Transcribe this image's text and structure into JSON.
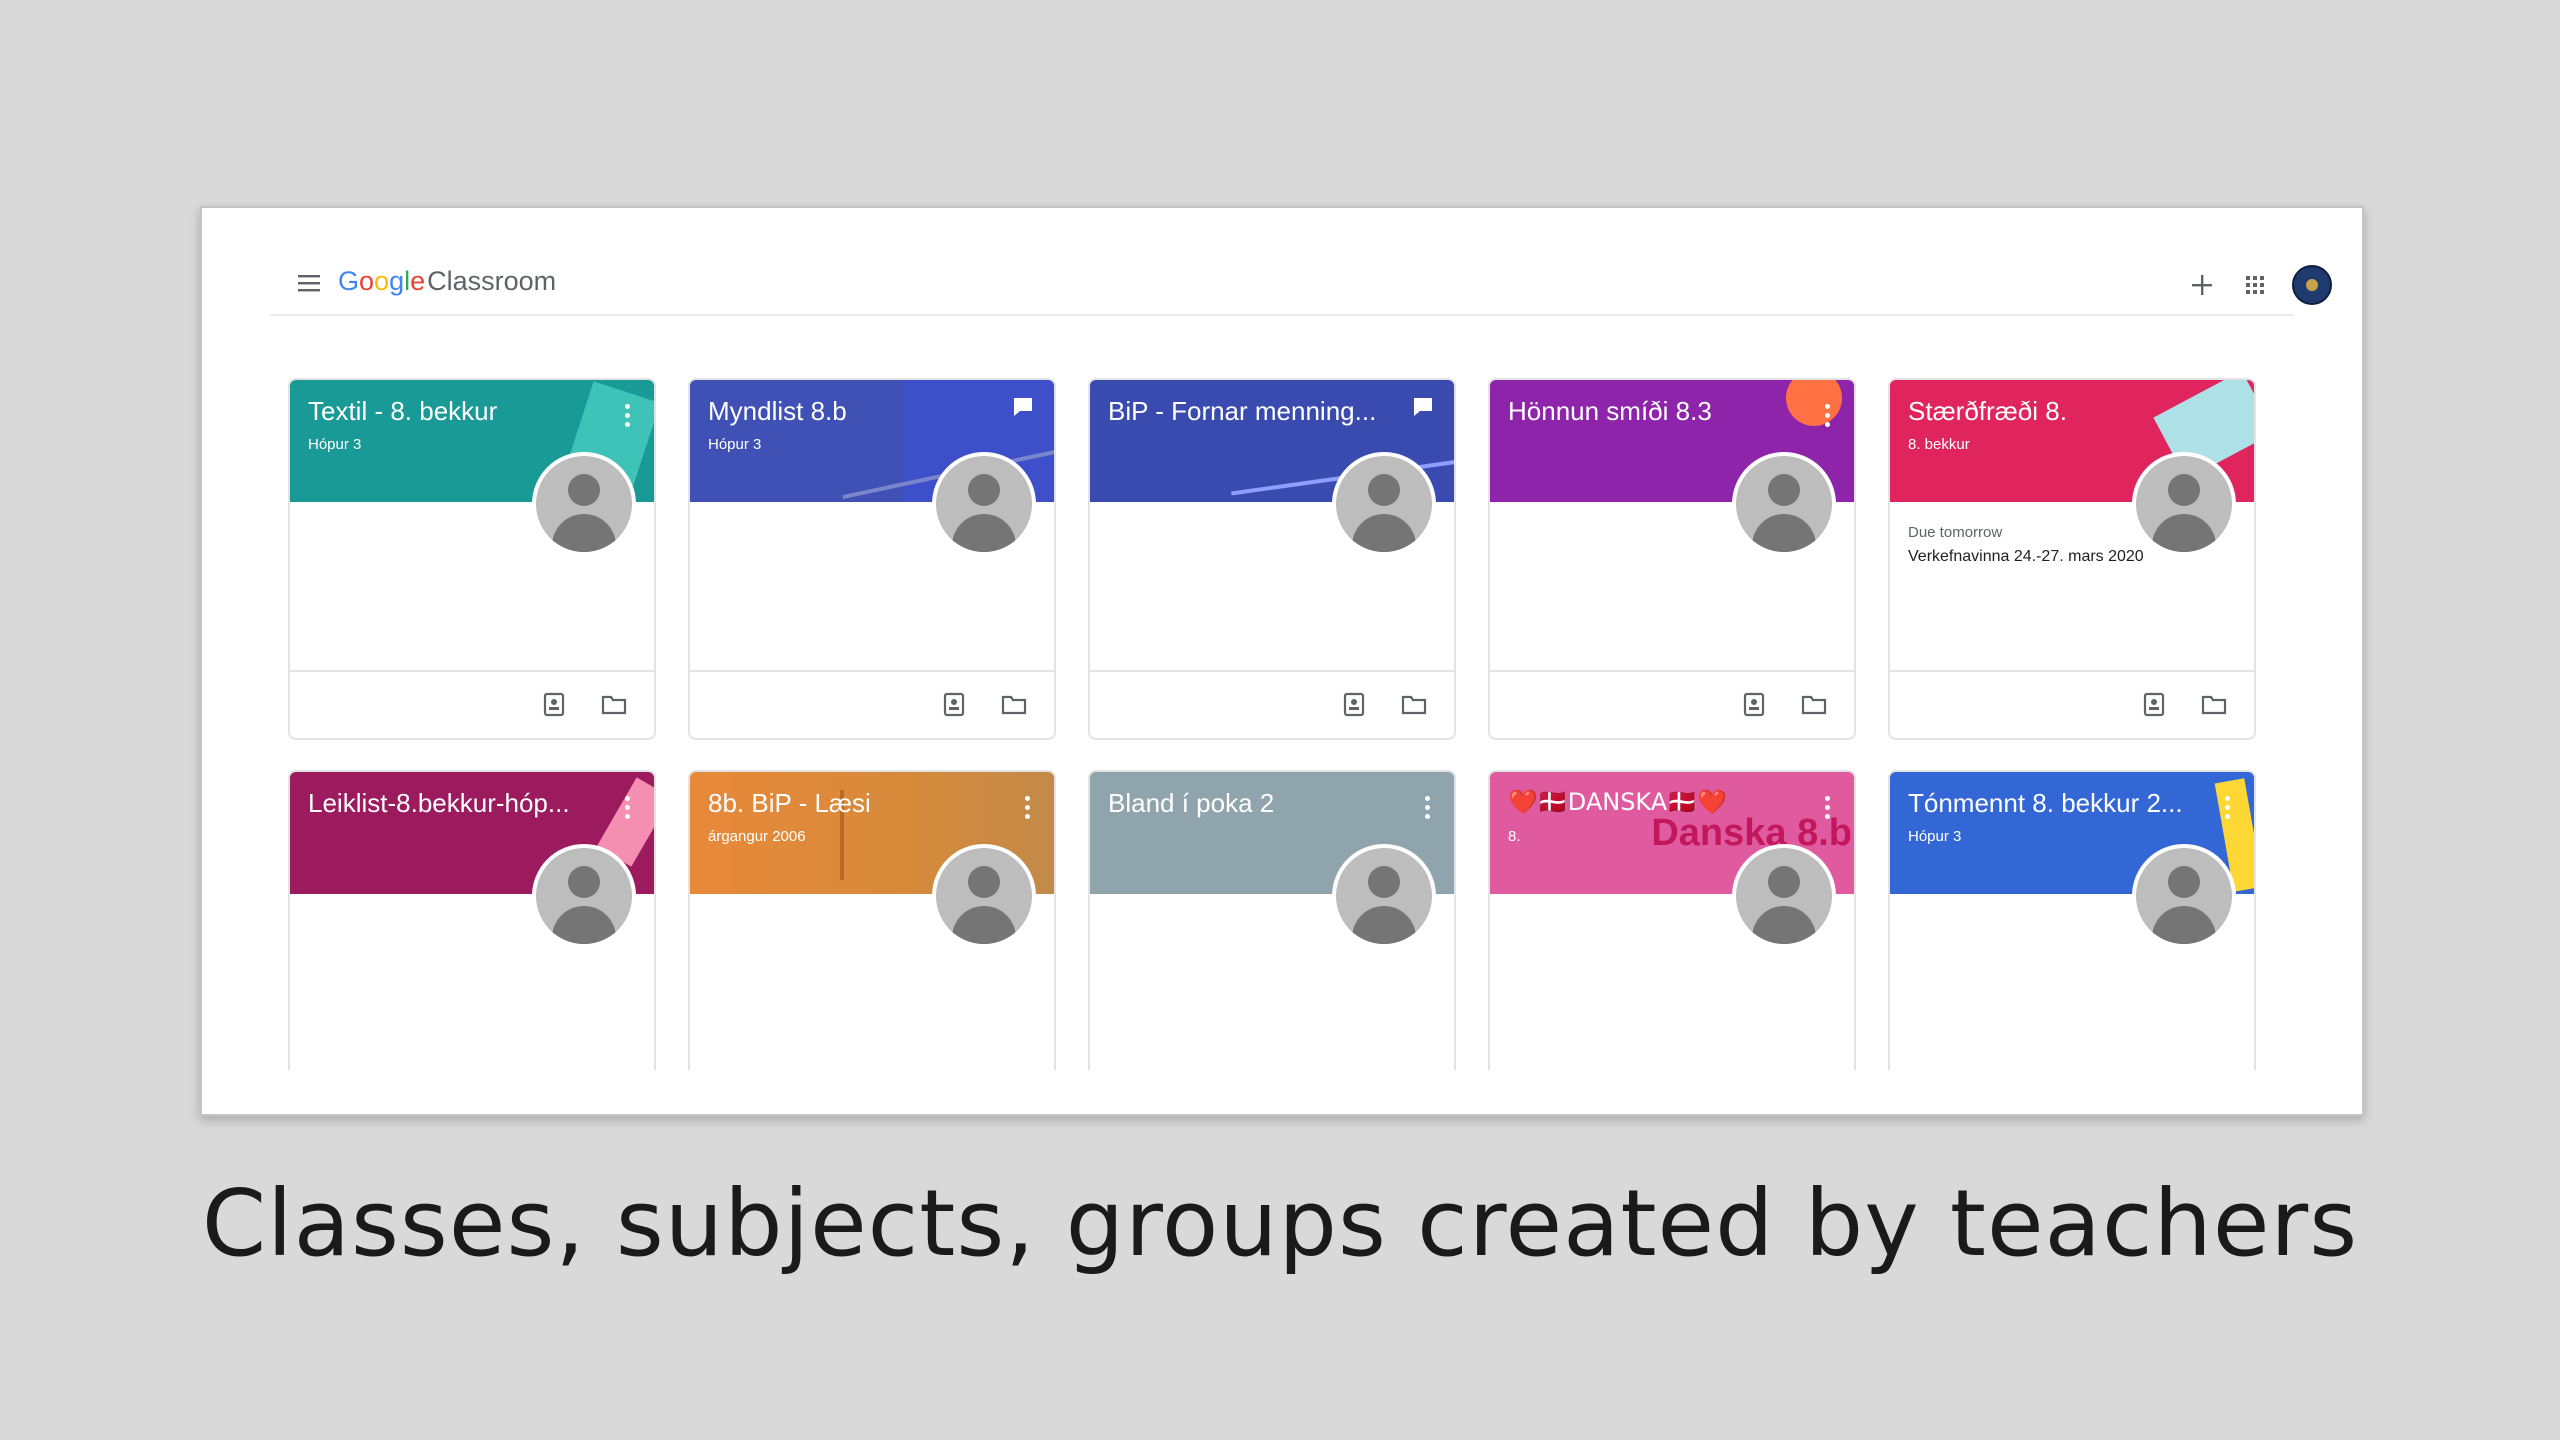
{
  "app": {
    "logo_google": [
      "G",
      "o",
      "o",
      "g",
      "l",
      "e"
    ],
    "logo_product": "Classroom"
  },
  "toolbar": {
    "menu_icon": "hamburger-menu-icon",
    "create_icon": "plus-icon",
    "apps_icon": "google-apps-grid-icon",
    "account_icon": "account-avatar"
  },
  "classes": [
    {
      "title": "Textil - 8. bekkur",
      "subtitle": "Hópur 3",
      "color": "#1a9a96",
      "action_icon": "more-vert-icon"
    },
    {
      "title": "Myndlist 8.b",
      "subtitle": "Hópur 3",
      "color": "#3f51b5",
      "action_icon": "chat-icon"
    },
    {
      "title": "BiP - Fornar menning...",
      "subtitle": "",
      "color": "#3a4bb0",
      "action_icon": "chat-icon"
    },
    {
      "title": "Hönnun smíði 8.3",
      "subtitle": "",
      "color": "#8e24aa",
      "action_icon": "more-vert-icon"
    },
    {
      "title": "Stærðfræði 8.",
      "subtitle": "8. bekkur",
      "color": "#e0245e",
      "action_icon": "more-vert-icon",
      "due_label": "Due tomorrow",
      "due_item": "Verkefnavinna 24.-27. mars 2020"
    },
    {
      "title": "Leiklist-8.bekkur-hóp...",
      "subtitle": "",
      "color": "#9c1a5e",
      "action_icon": "more-vert-icon"
    },
    {
      "title": "8b. BiP - Læsi",
      "subtitle": "árgangur 2006",
      "color": "#e8893a",
      "action_icon": "more-vert-icon"
    },
    {
      "title": "Bland í poka 2",
      "subtitle": "",
      "color": "#90a4ae",
      "action_icon": "more-vert-icon"
    },
    {
      "title": "❤️🇩🇰DANSKA🇩🇰❤️",
      "subtitle": "8.",
      "color": "#e05aa0",
      "action_icon": "more-vert-icon",
      "banner_text": "Danska 8.b"
    },
    {
      "title": "Tónmennt 8. bekkur 2...",
      "subtitle": "Hópur 3",
      "color": "#3367d6",
      "action_icon": "more-vert-icon"
    }
  ],
  "card_footer_icons": [
    "assignment-icon",
    "folder-icon"
  ],
  "caption": "Classes, subjects, groups created by teachers"
}
